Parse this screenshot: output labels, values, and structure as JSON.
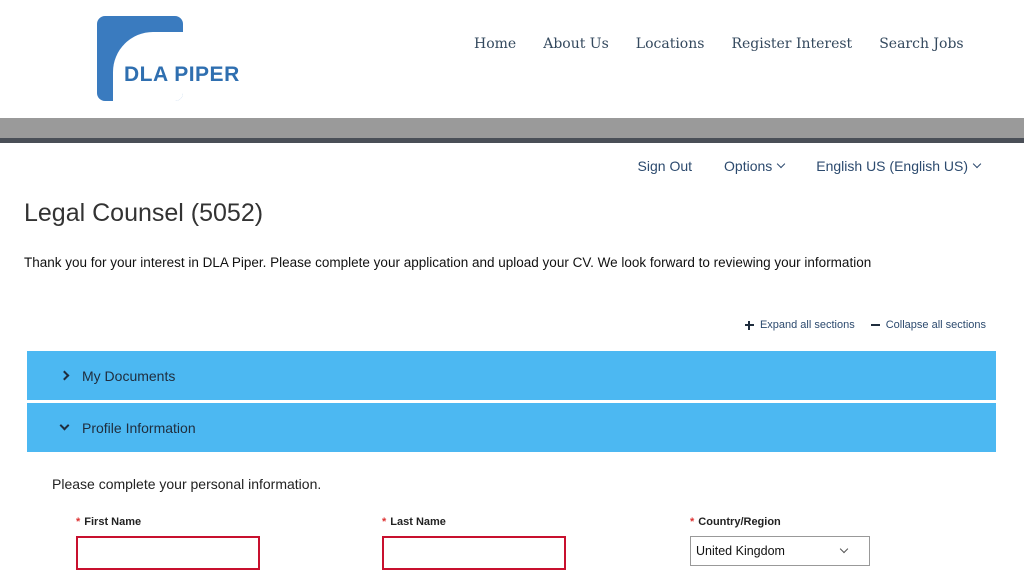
{
  "brand": {
    "logo_text": "DLA PIPER"
  },
  "nav": [
    "Home",
    "About Us",
    "Locations",
    "Register Interest",
    "Search Jobs"
  ],
  "util_nav": {
    "sign_out": "Sign Out",
    "options": "Options",
    "language": "English US (English US)"
  },
  "page": {
    "title": "Legal Counsel (5052)",
    "intro": "Thank you for your interest in DLA Piper. Please complete your application and upload your CV. We look forward to reviewing your information"
  },
  "section_controls": {
    "expand": "Expand all sections",
    "collapse": "Collapse all sections"
  },
  "sections": [
    {
      "label": "My Documents",
      "expanded": false
    },
    {
      "label": "Profile Information",
      "expanded": true
    }
  ],
  "profile": {
    "instruction": "Please complete your personal information.",
    "first_name": {
      "label": "First Name",
      "value": ""
    },
    "last_name": {
      "label": "Last Name",
      "value": ""
    },
    "country": {
      "label": "Country/Region",
      "value": "United Kingdom"
    }
  },
  "colors": {
    "accent": "#4cb8f2",
    "brand": "#3a7bbf",
    "required": "#c8102e"
  }
}
